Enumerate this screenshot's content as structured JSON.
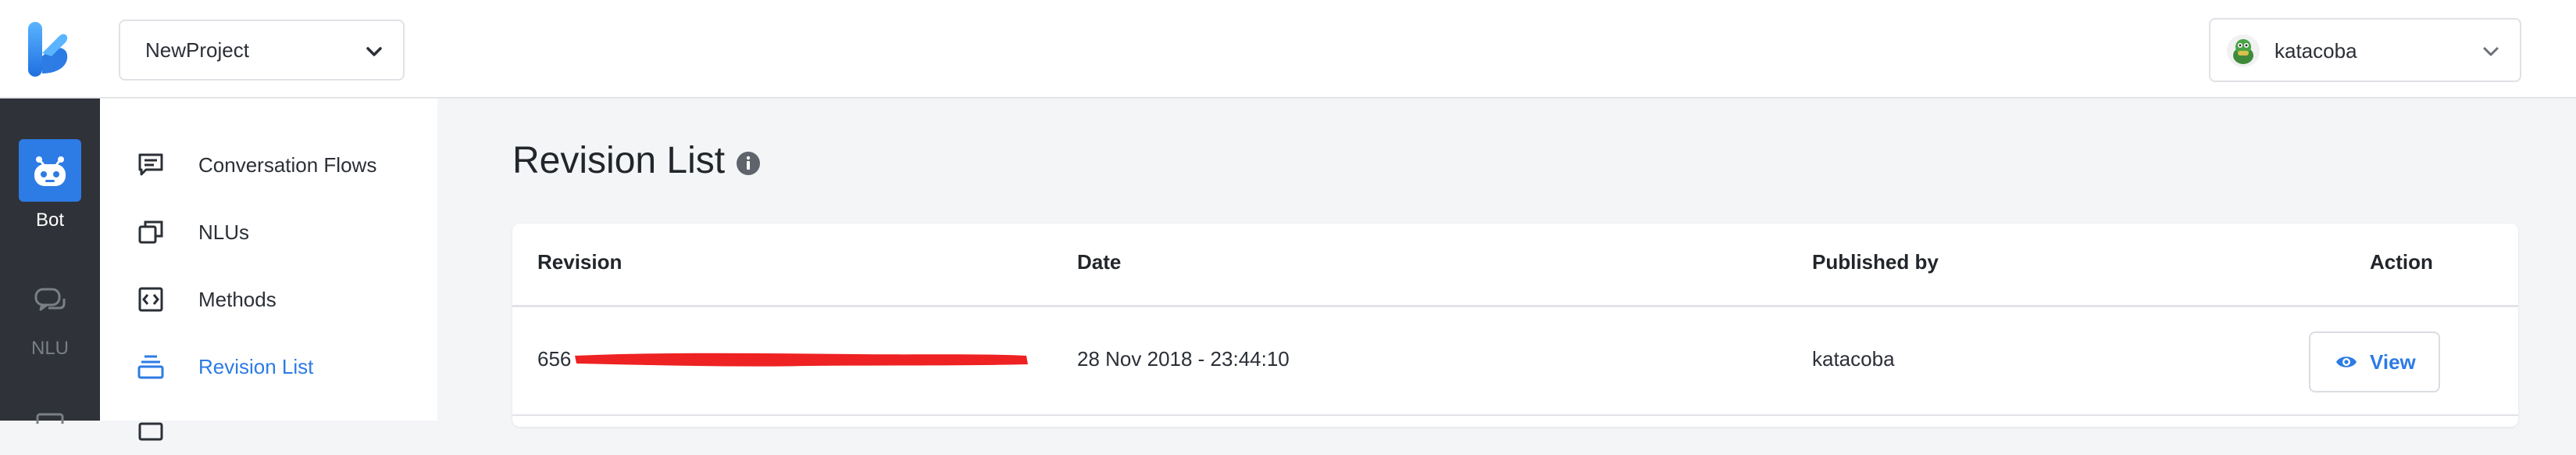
{
  "header": {
    "project_name": "NewProject",
    "user_name": "katacoba"
  },
  "rail": {
    "items": [
      {
        "label": "Bot",
        "active": true
      },
      {
        "label": "NLU",
        "active": false
      }
    ]
  },
  "sidebar": {
    "items": [
      {
        "label": "Conversation Flows",
        "icon": "chat-icon"
      },
      {
        "label": "NLUs",
        "icon": "copy-icon"
      },
      {
        "label": "Methods",
        "icon": "code-icon"
      },
      {
        "label": "Revision List",
        "icon": "stack-icon",
        "active": true
      }
    ]
  },
  "main": {
    "title": "Revision List",
    "table": {
      "columns": [
        "Revision",
        "Date",
        "Published by",
        "Action"
      ],
      "rows": [
        {
          "revision": "656",
          "date": "28 Nov 2018 - 23:44:10",
          "published_by": "katacoba",
          "action": "View"
        }
      ]
    }
  },
  "colors": {
    "accent": "#2d7be5",
    "rail_bg": "#2f3238",
    "page_bg": "#f4f5f7",
    "redaction": "#ee2222"
  }
}
